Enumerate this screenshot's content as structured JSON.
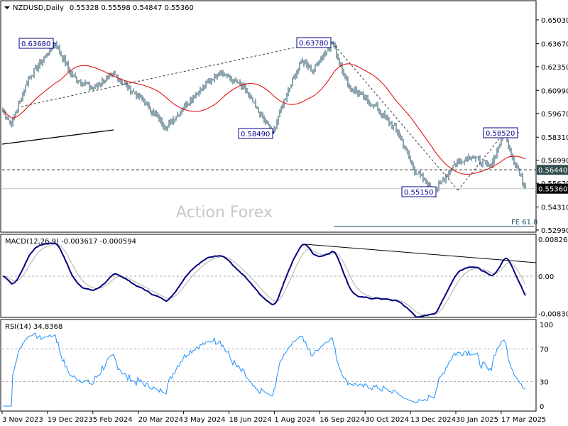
{
  "header": {
    "symbol": "NZDUSD,Daily",
    "ohlc": "0.55328 0.55598 0.54847 0.55360"
  },
  "watermark": "Action Forex",
  "chart_data": [
    {
      "type": "line",
      "panel": "price",
      "title": "NZDUSD,Daily",
      "yticks": [
        "0.65030",
        "0.63670",
        "0.62350",
        "0.60990",
        "0.59670",
        "0.58310",
        "0.56990",
        "0.55670",
        "0.54310",
        "0.52990"
      ],
      "ylim": [
        0.5299,
        0.6503
      ],
      "xticks": [
        "3 Nov 2023",
        "19 Dec 2023",
        "5 Feb 2024",
        "20 Mar 2024",
        "3 May 2024",
        "18 Jun 2024",
        "1 Aug 2024",
        "16 Sep 2024",
        "30 Oct 2024",
        "13 Dec 2024",
        "30 Jan 2025",
        "17 Mar 2025"
      ],
      "price_path": [
        [
          0,
          0.5986
        ],
        [
          6,
          0.5905
        ],
        [
          18,
          0.617
        ],
        [
          37,
          0.6368
        ],
        [
          48,
          0.619
        ],
        [
          63,
          0.6109
        ],
        [
          78,
          0.619
        ],
        [
          98,
          0.6048
        ],
        [
          115,
          0.5885
        ],
        [
          130,
          0.6028
        ],
        [
          153,
          0.6211
        ],
        [
          170,
          0.6109
        ],
        [
          190,
          0.5849
        ],
        [
          197,
          0.602
        ],
        [
          210,
          0.6272
        ],
        [
          218,
          0.621
        ],
        [
          232,
          0.6378
        ],
        [
          243,
          0.613
        ],
        [
          263,
          0.6
        ],
        [
          278,
          0.5865
        ],
        [
          290,
          0.564
        ],
        [
          304,
          0.5515
        ],
        [
          318,
          0.568
        ],
        [
          330,
          0.572
        ],
        [
          343,
          0.566
        ],
        [
          353,
          0.5852
        ],
        [
          360,
          0.57
        ],
        [
          368,
          0.5536
        ]
      ],
      "labels": [
        "0.63680",
        "0.63780",
        "0.58490",
        "0.55150",
        "0.58520"
      ],
      "current_price": "0.55360",
      "level": "0.56440",
      "fe_label": "FE 61.8",
      "colors": {
        "bars": "#1b4a5e",
        "ma": "#e00000",
        "label_box": "#00008b"
      }
    },
    {
      "type": "line",
      "panel": "macd",
      "title": "MACD(12,26,9) -0.003617 -0.000594",
      "yticks": [
        "0.008265",
        "0.00",
        "-0.008307"
      ],
      "ylim": [
        -0.008307,
        0.008265
      ],
      "colors": {
        "macd": "#00007f",
        "signal": "#b0b0b0"
      }
    },
    {
      "type": "line",
      "panel": "rsi",
      "title": "RSI(14) 34.8368",
      "yticks": [
        "100",
        "70",
        "30",
        "0"
      ],
      "ylim": [
        0,
        100
      ],
      "levels": [
        70,
        30
      ],
      "colors": {
        "rsi": "#1e90ff"
      }
    }
  ]
}
